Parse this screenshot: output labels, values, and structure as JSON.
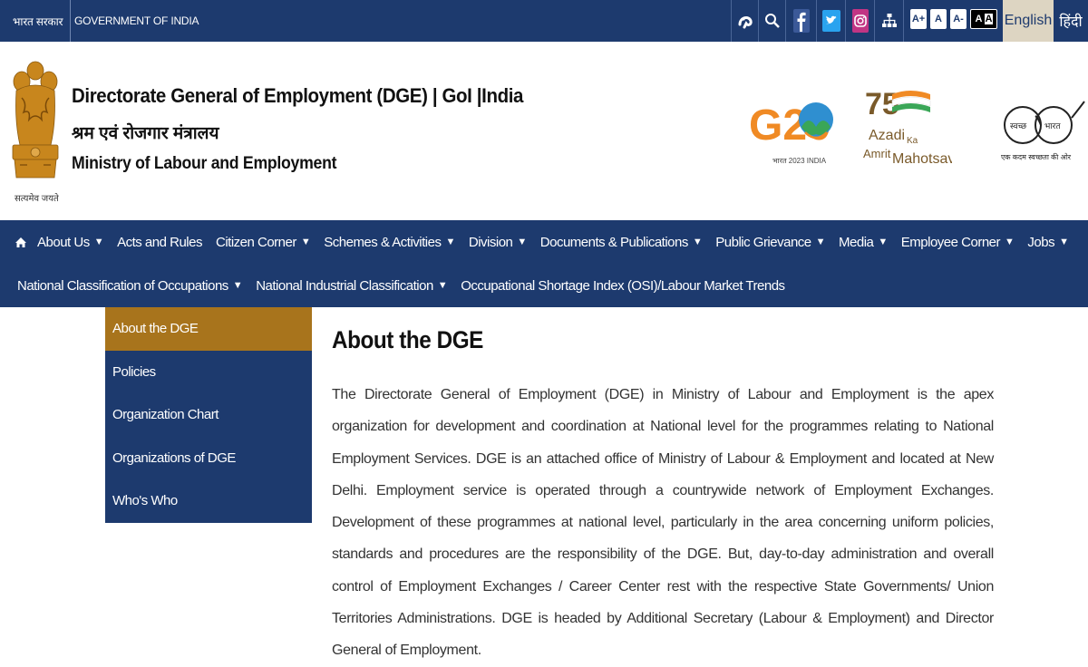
{
  "topbar": {
    "gov_hindi": "भारत सरकार",
    "gov_english": "GOVERNMENT OF INDIA",
    "icons": [
      "accessibility-icon",
      "search-icon",
      "facebook-icon",
      "twitter-icon",
      "instagram-icon",
      "sitemap-icon"
    ],
    "font_sizes": [
      "A+",
      "A",
      "A-",
      "A"
    ],
    "lang_english": "English",
    "lang_hindi": "हिंदी"
  },
  "header": {
    "title_en": "Directorate General of Employment (DGE) | GoI |India",
    "title_hi": "श्रम एवं रोजगार मंत्रालय",
    "ministry": "Ministry of Labour and Employment",
    "emblem_caption": "सत्यमेव जयते",
    "logos": {
      "g20": "G20",
      "g20_caption": "भारत 2023 INDIA",
      "azadi_number": "75",
      "azadi_line1": "Azadi",
      "azadi_ka": "Ka",
      "azadi_line2": "Amrit",
      "azadi_line3": "Mahotsav",
      "swachh_left": "स्वच्छ",
      "swachh_right": "भारत",
      "swachh_caption": "एक कदम स्वच्छता की ओर"
    }
  },
  "nav": {
    "row1": [
      {
        "label": "About Us",
        "dropdown": true
      },
      {
        "label": "Acts and Rules",
        "dropdown": false
      },
      {
        "label": "Citizen Corner",
        "dropdown": true
      },
      {
        "label": "Schemes & Activities",
        "dropdown": true
      },
      {
        "label": "Division",
        "dropdown": true
      },
      {
        "label": "Documents & Publications",
        "dropdown": true
      },
      {
        "label": "Public Grievance",
        "dropdown": true
      },
      {
        "label": "Media",
        "dropdown": true
      },
      {
        "label": "Employee Corner",
        "dropdown": true
      },
      {
        "label": "Jobs",
        "dropdown": true
      }
    ],
    "row2": [
      {
        "label": "National Classification of Occupations",
        "dropdown": true
      },
      {
        "label": "National Industrial Classification",
        "dropdown": true
      },
      {
        "label": "Occupational Shortage Index (OSI)/Labour Market Trends",
        "dropdown": false
      }
    ],
    "caret": "▼"
  },
  "sidebar": {
    "items": [
      "About the DGE",
      "Policies",
      "Organization Chart",
      "Organizations of DGE",
      "Who's Who"
    ],
    "active_index": 0
  },
  "content": {
    "title": "About the DGE",
    "body": "The Directorate General of Employment (DGE) in Ministry of Labour and Employment is the apex organization for development and coordination at National level for the programmes relating to National Employment Services. DGE is an attached office of Ministry of Labour & Employment and located at New Delhi. Employment service is operated through a countrywide network of Employment Exchanges. Development of these programmes at national level, particularly in the area concerning uniform policies, standards and procedures are the responsibility of the DGE. But, day-to-day administration and overall control of Employment Exchanges / Career Center rest with the respective State Governments/ Union Territories Administrations. DGE is headed by Additional Secretary (Labour & Employment) and Director General of Employment."
  },
  "colors": {
    "primary_navy": "#1d3a6e",
    "active_gold": "#a8741c",
    "lang_active_bg": "#ddd5c2"
  }
}
